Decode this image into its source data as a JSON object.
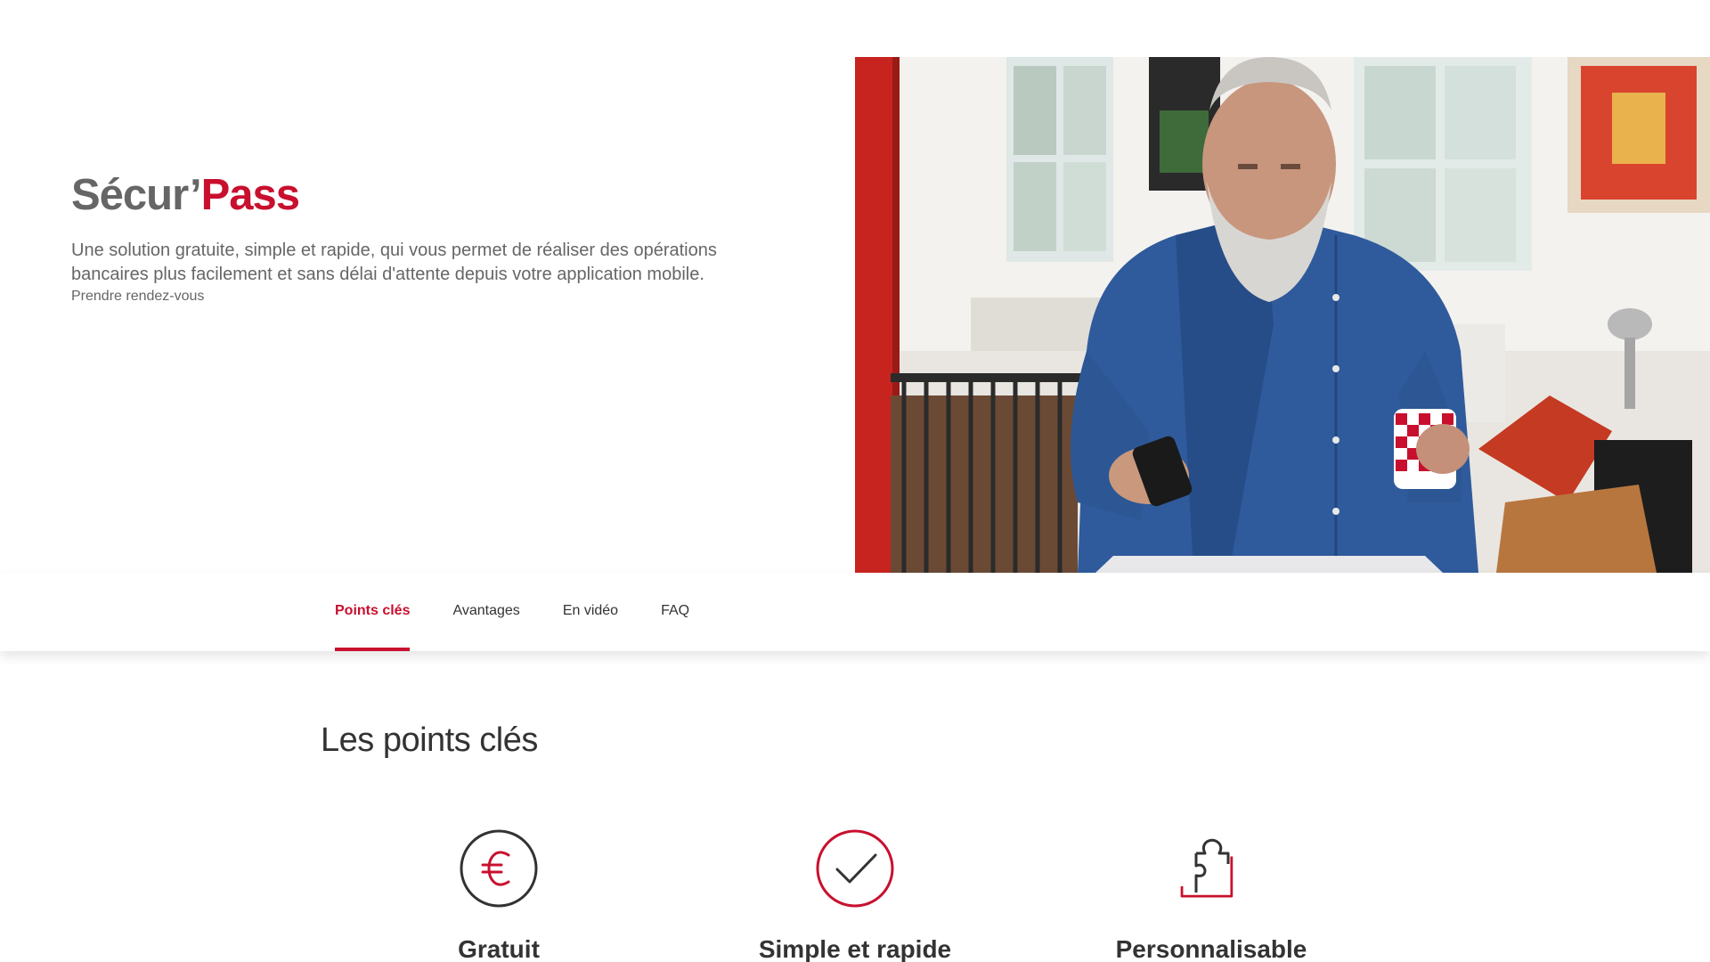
{
  "hero": {
    "title_part1": "Sécur’",
    "title_part2": "Pass",
    "description": "Une solution gratuite, simple et rapide, qui vous permet de réaliser des opérations bancaires plus facilement et sans délai d'attente depuis votre application mobile.",
    "cta_link": "Prendre rendez-vous",
    "image_alt": "man-with-phone-and-mug-photo"
  },
  "tabs": [
    {
      "label": "Points clés",
      "active": true
    },
    {
      "label": "Avantages",
      "active": false
    },
    {
      "label": "En vidéo",
      "active": false
    },
    {
      "label": "FAQ",
      "active": false
    }
  ],
  "key_points": {
    "title": "Les points clés",
    "items": [
      {
        "icon": "euro-icon",
        "label": "Gratuit"
      },
      {
        "icon": "check-icon",
        "label": "Simple et rapide"
      },
      {
        "icon": "puzzle-icon",
        "label": "Personnalisable"
      }
    ]
  },
  "colors": {
    "accent": "#c8102e",
    "text_gray": "#666666",
    "text_dark": "#333333"
  }
}
